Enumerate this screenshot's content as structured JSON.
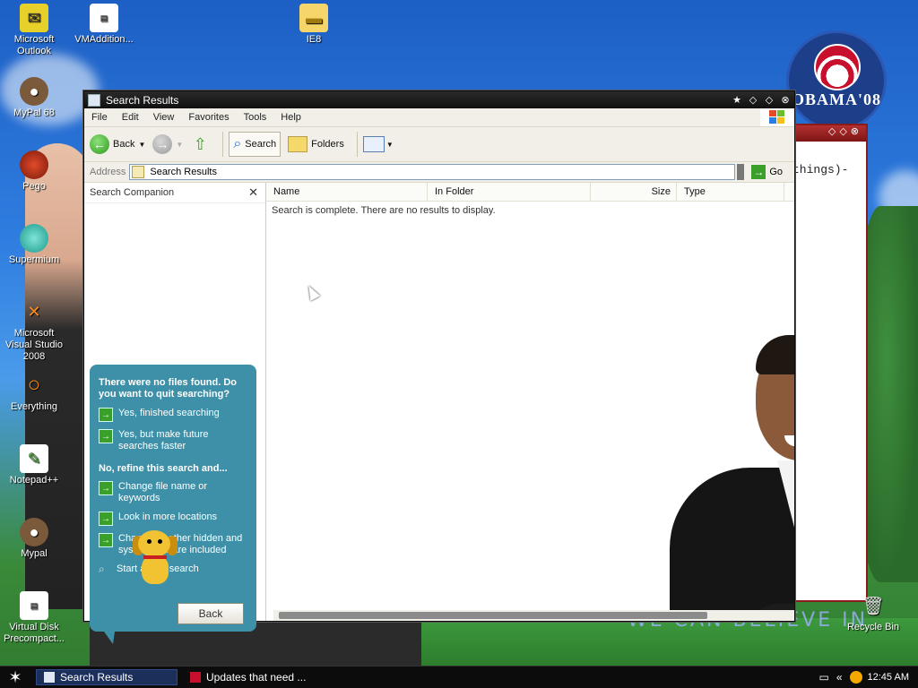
{
  "desktop": {
    "icons": [
      {
        "label": "Microsoft Outlook",
        "icon": "outlook-icon"
      },
      {
        "label": "VMAddition...",
        "icon": "vm-additions-icon"
      },
      {
        "label": "IE8",
        "icon": "folder-icon"
      },
      {
        "label": "MyPal 68",
        "icon": "mypal-icon"
      },
      {
        "label": "Pego",
        "icon": "pego-icon"
      },
      {
        "label": "Supermium",
        "icon": "supermium-icon"
      },
      {
        "label": "Microsoft Visual Studio 2008",
        "icon": "visual-studio-icon"
      },
      {
        "label": "Everything",
        "icon": "everything-icon"
      },
      {
        "label": "Notepad++",
        "icon": "notepadpp-icon"
      },
      {
        "label": "Mypal",
        "icon": "mypal-icon"
      },
      {
        "label": "Virtual Disk Precompact...",
        "icon": "virtual-disk-icon"
      },
      {
        "label": "Recycle Bin",
        "icon": "recycle-bin-icon"
      }
    ],
    "logo_text": "OBAMA'08",
    "slogan": "WE CAN BELIEVE IN",
    "background_window_text": "things)-"
  },
  "window": {
    "title": "Search Results",
    "menu": [
      "File",
      "Edit",
      "View",
      "Favorites",
      "Tools",
      "Help"
    ],
    "toolbar": {
      "back": "Back",
      "search": "Search",
      "folders": "Folders"
    },
    "address": {
      "label": "Address",
      "value": "Search Results",
      "go": "Go"
    },
    "companion": {
      "title": "Search Companion",
      "question": "There were no files found. Do you want to quit searching?",
      "opt1": "Yes, finished searching",
      "opt2": "Yes, but make future searches faster",
      "refine_heading": "No, refine this search and...",
      "opt3": "Change file name or keywords",
      "opt4": "Look in more locations",
      "opt5": "Change whether hidden and system files are included",
      "opt6": "Start a new search",
      "back_button": "Back"
    },
    "columns": [
      "Name",
      "In Folder",
      "Size",
      "Type"
    ],
    "empty_message": "Search is complete. There are no results to display."
  },
  "taskbar": {
    "items": [
      "Search Results",
      "Updates that need ..."
    ],
    "clock": "12:45 AM"
  }
}
